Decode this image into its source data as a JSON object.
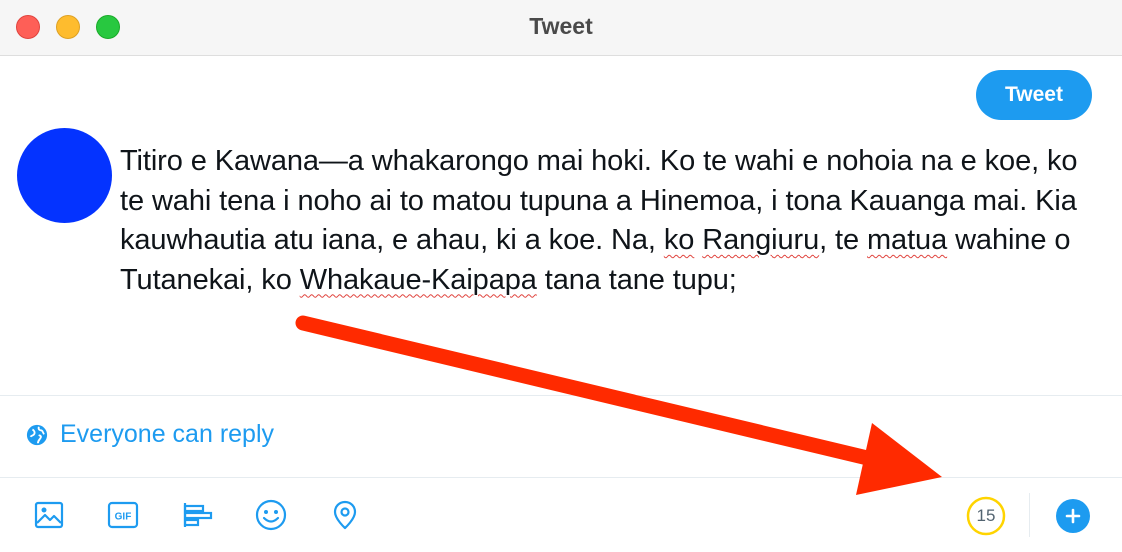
{
  "window": {
    "title": "Tweet"
  },
  "toolbar": {
    "tweet_label": "Tweet"
  },
  "compose": {
    "text_parts": [
      "Titiro e Kawana—a whakarongo mai hoki. Ko te wahi e nohoia na e koe, ko te wahi tena i noho ai to matou tupuna a Hinemoa, i tona Kauanga mai. Kia kauwhautia atu iana, e ahau, ki a koe. Na, ",
      "ko",
      " ",
      "Rangiuru",
      ", te ",
      "matua",
      " wahine o Tutanekai, ko ",
      "Whakaue-Kaipapa",
      " tana tane tupu;"
    ]
  },
  "reply_setting": {
    "label": "Everyone can reply"
  },
  "bottom_toolbar": {
    "icons": [
      "image-icon",
      "gif-icon",
      "poll-icon",
      "emoji-icon",
      "location-icon"
    ],
    "gif_label": "GIF",
    "char_counter": "15",
    "counter_color": "#ffd400"
  },
  "colors": {
    "accent": "#1d9bf0",
    "avatar": "#0433ff",
    "annotation_arrow": "#ff2a00"
  }
}
